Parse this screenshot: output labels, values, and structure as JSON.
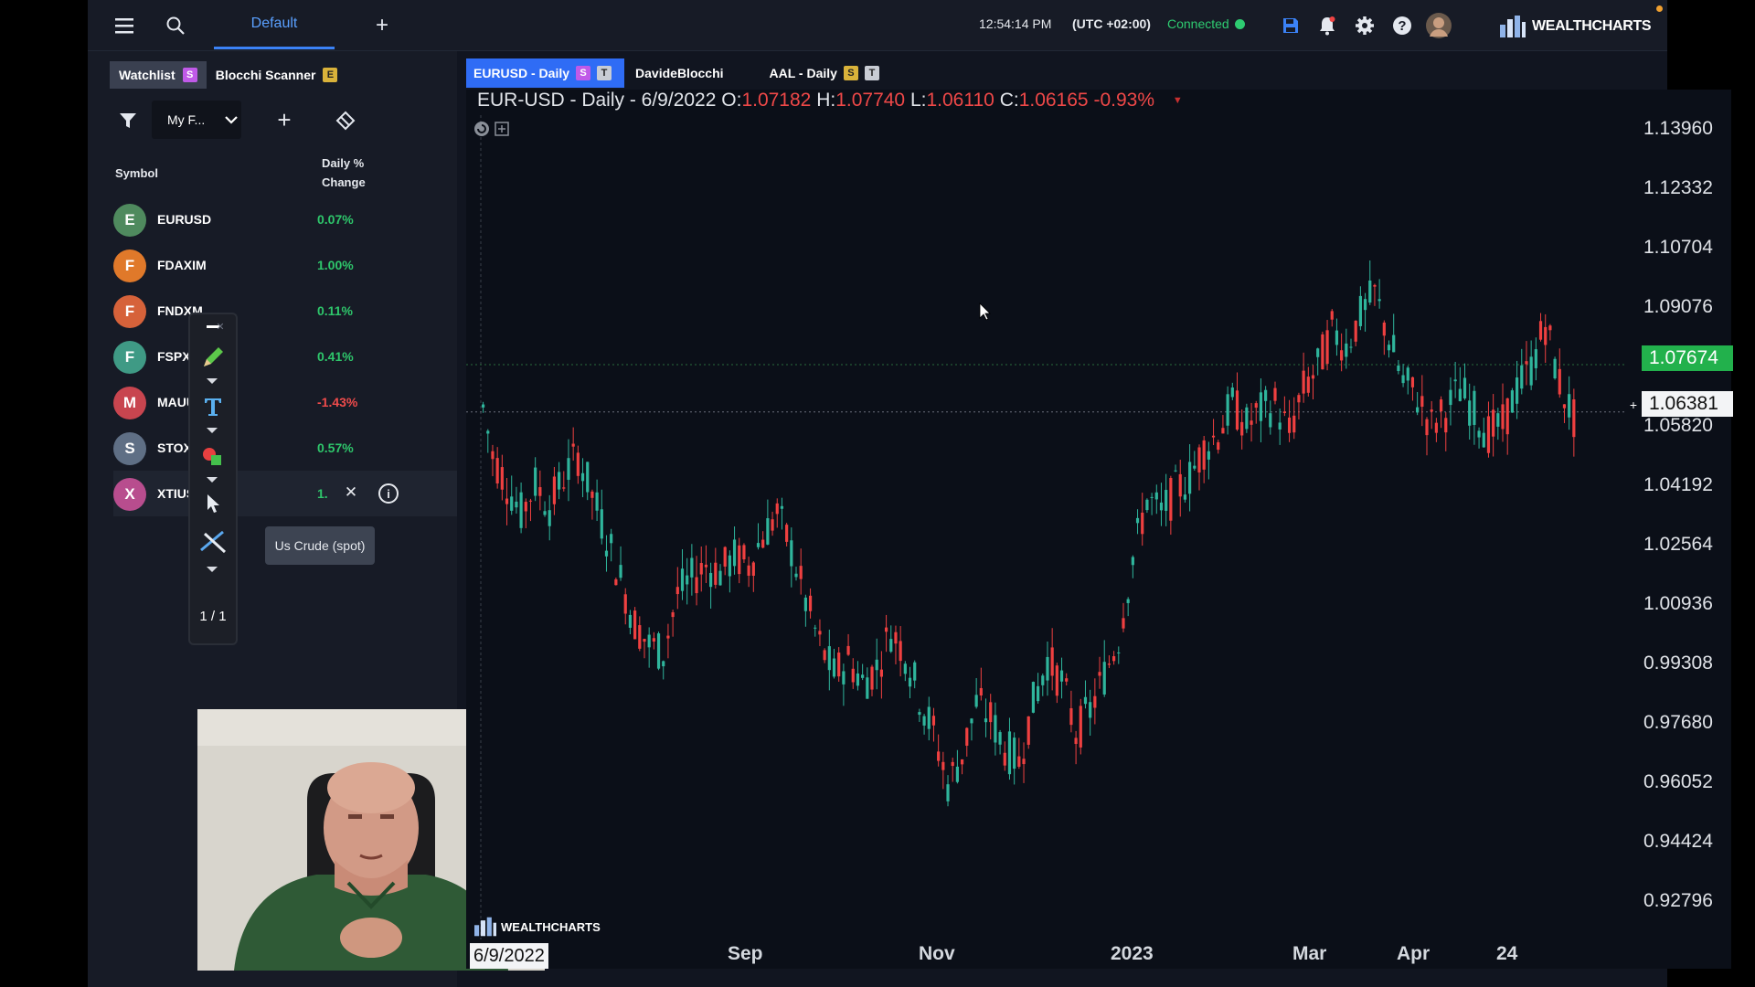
{
  "topbar": {
    "tab_default": "Default",
    "time": "12:54:14 PM",
    "timezone": "(UTC +02:00)",
    "connection": "Connected",
    "brand": "WEALTHCHARTS",
    "icons": [
      "menu-icon",
      "search-icon",
      "plus-icon",
      "save-icon",
      "bell-icon",
      "gear-icon",
      "help-icon",
      "user-avatar"
    ]
  },
  "left_panel": {
    "tabs": [
      {
        "label": "Watchlist",
        "badge": "S",
        "badge_color": "#c05ae8"
      },
      {
        "label": "Blocchi Scanner",
        "badge": "E",
        "badge_color": "#d9b23a"
      }
    ],
    "filter_select": "My F...",
    "header_symbol": "Symbol",
    "header_change_1": "Daily %",
    "header_change_2": "Change",
    "rows": [
      {
        "letter": "E",
        "symbol": "EURUSD",
        "change": "0.07%",
        "color": "#4f8a5e",
        "dir": "pos"
      },
      {
        "letter": "F",
        "symbol": "FDAXIM",
        "change": "1.00%",
        "color": "#e0792a",
        "dir": "pos"
      },
      {
        "letter": "F",
        "symbol": "FNDXM",
        "change": "0.11%",
        "color": "#d6623a",
        "dir": "pos"
      },
      {
        "letter": "F",
        "symbol": "FSPXM",
        "change": "0.41%",
        "color": "#3f9a85",
        "dir": "pos"
      },
      {
        "letter": "M",
        "symbol": "MAUUSD",
        "change": "-1.43%",
        "color": "#c8454f",
        "dir": "neg"
      },
      {
        "letter": "S",
        "symbol": "STOXX5",
        "change": "0.57%",
        "color": "#5f6f85",
        "dir": "pos"
      },
      {
        "letter": "X",
        "symbol": "XTIUSD",
        "change": "1.",
        "color": "#b84d8e",
        "dir": "pos"
      }
    ],
    "tooltip": "Us Crude (spot)"
  },
  "drawing_toolbar": {
    "page": "1 / 1",
    "tools": [
      "minus-icon",
      "pencil-icon",
      "text-icon",
      "shapes-icon",
      "cursor-icon",
      "line-tool-icon"
    ]
  },
  "chart_tabs": [
    {
      "label": "EURUSD - Daily",
      "badges": [
        "S",
        "T"
      ],
      "active": true
    },
    {
      "label": "DavideBlocchi",
      "badges": [],
      "active": false
    },
    {
      "label": "AAL - Daily",
      "badges": [
        "S",
        "T"
      ],
      "active": false
    }
  ],
  "chart_header": {
    "symbol": "EUR-USD - Daily - 6/9/2022",
    "o_label": "O:",
    "o": "1.07182",
    "h_label": "H:",
    "h": "1.07740",
    "l_label": "L:",
    "l": "1.06110",
    "c_label": "C:",
    "c": "1.06165",
    "change": "-0.93%"
  },
  "chart_data": {
    "type": "candlestick",
    "symbol": "EUR-USD",
    "timeframe": "Daily",
    "y_ticks": [
      "1.13960",
      "1.12332",
      "1.10704",
      "1.09076",
      "1.05820",
      "1.04192",
      "1.02564",
      "1.00936",
      "0.99308",
      "0.97680",
      "0.96052",
      "0.94424",
      "0.92796"
    ],
    "ylim": [
      0.922,
      1.145
    ],
    "x_ticks": [
      "Sep",
      "Nov",
      "2023",
      "Mar",
      "Apr",
      "24"
    ],
    "current_price": "1.07674",
    "crosshair_price": "1.06381",
    "crosshair_date": "6/9/2022",
    "up_color": "#2fb59c",
    "down_color": "#ef4040",
    "closes": [
      1.0717,
      1.052,
      1.044,
      1.036,
      1.044,
      1.038,
      1.046,
      1.052,
      1.041,
      1.03,
      1.018,
      1.006,
      1.0,
      0.998,
      1.014,
      1.018,
      1.022,
      1.02,
      1.024,
      1.022,
      1.03,
      1.036,
      1.026,
      1.012,
      1.0,
      0.992,
      0.996,
      0.99,
      0.994,
      1.004,
      0.998,
      0.986,
      0.976,
      0.962,
      0.97,
      0.984,
      0.98,
      0.972,
      0.968,
      0.984,
      0.996,
      0.99,
      0.976,
      0.982,
      0.992,
      1.002,
      1.024,
      1.04,
      1.036,
      1.042,
      1.046,
      1.054,
      1.058,
      1.066,
      1.06,
      1.064,
      1.066,
      1.058,
      1.07,
      1.076,
      1.086,
      1.082,
      1.09,
      1.096,
      1.084,
      1.072,
      1.068,
      1.06,
      1.064,
      1.07,
      1.064,
      1.058,
      1.06,
      1.07,
      1.076,
      1.088,
      1.0717,
      1.0617
    ]
  }
}
